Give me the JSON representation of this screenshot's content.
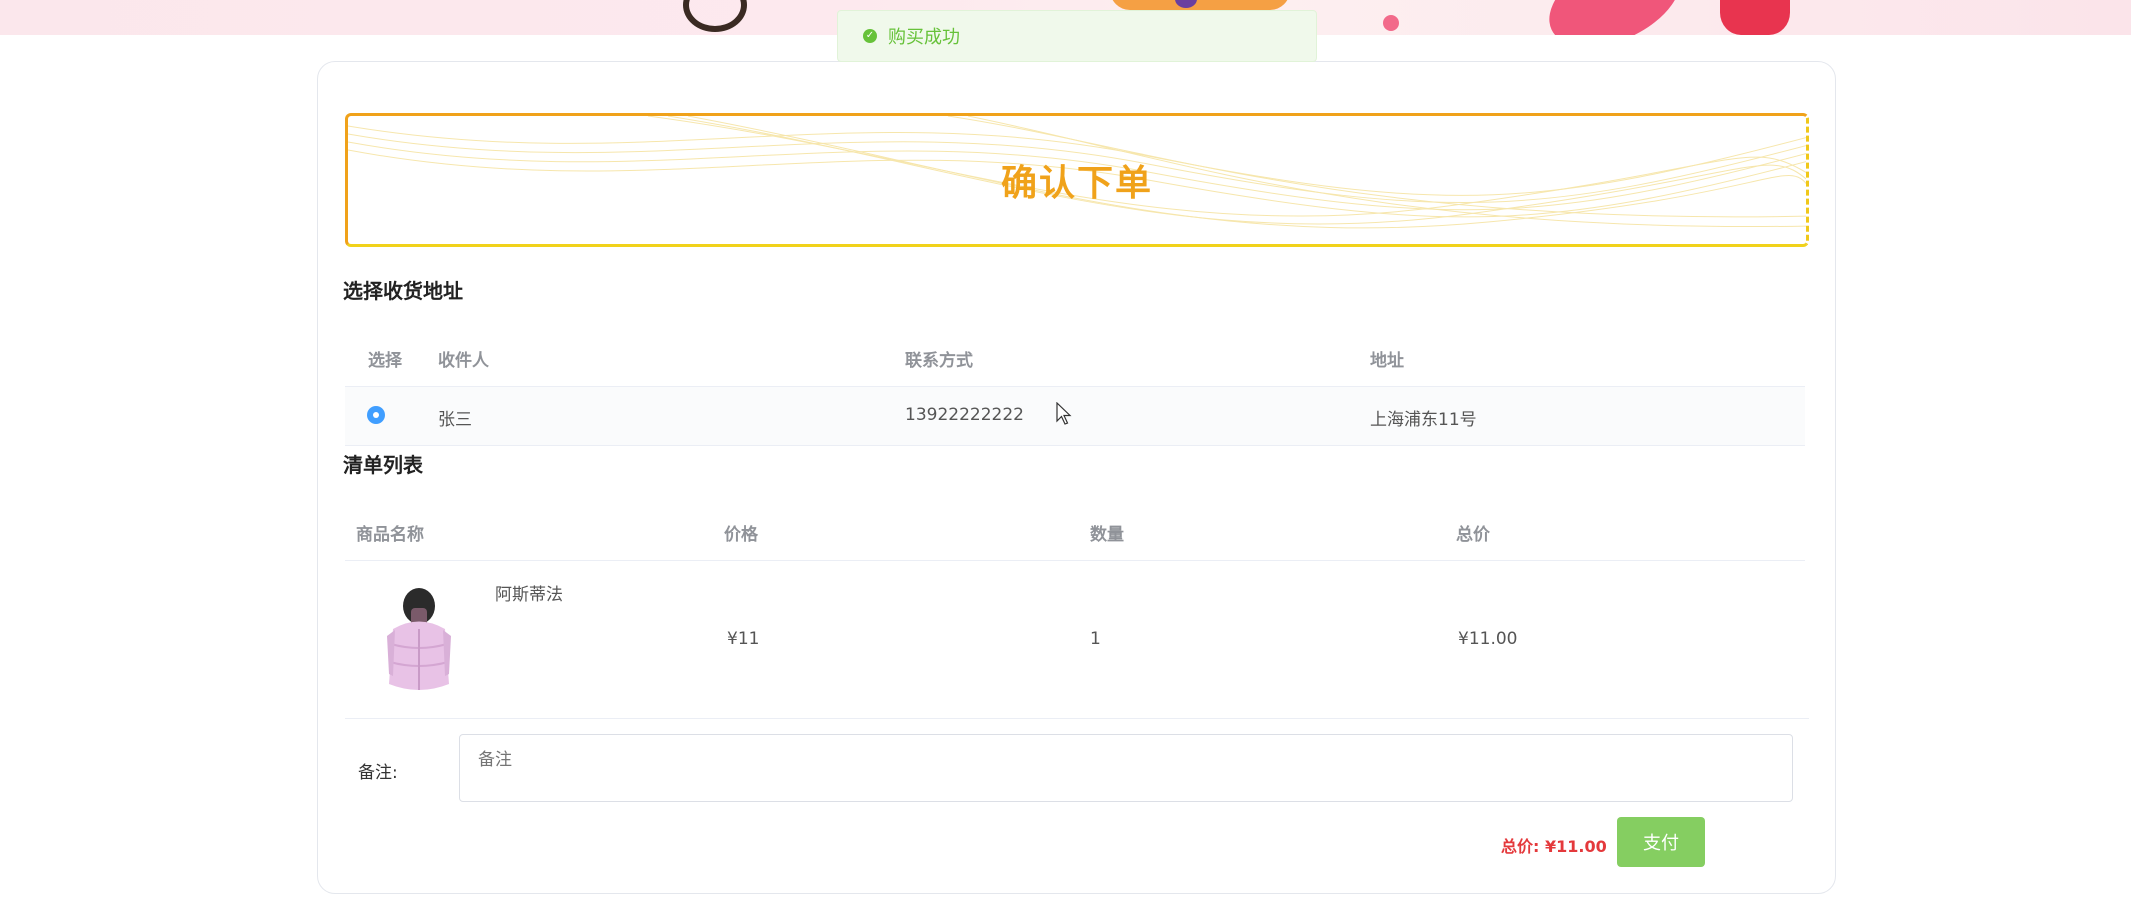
{
  "toast": {
    "message": "购买成功"
  },
  "page_title": "确认下单",
  "address_section": {
    "title": "选择收货地址",
    "columns": [
      "选择",
      "收件人",
      "联系方式",
      "地址"
    ],
    "rows": [
      {
        "selected": true,
        "recipient": "张三",
        "phone": "13922222222",
        "address": "上海浦东11号"
      }
    ]
  },
  "order_section": {
    "title": "清单列表",
    "columns": [
      "商品名称",
      "价格",
      "数量",
      "总价"
    ],
    "items": [
      {
        "name": "阿斯蒂法",
        "price": "¥11",
        "quantity": "1",
        "total": "¥11.00",
        "image_icon": "pink-puffer-vest-image"
      }
    ]
  },
  "note": {
    "label": "备注:",
    "placeholder": "备注",
    "value": ""
  },
  "summary": {
    "total_label": "总价: ¥11.00",
    "pay_label": "支付"
  },
  "colors": {
    "accent": "#f0a21a",
    "success": "#67c23a",
    "radio": "#409eff",
    "price": "#e4393c",
    "pay_button": "#85ce61"
  }
}
